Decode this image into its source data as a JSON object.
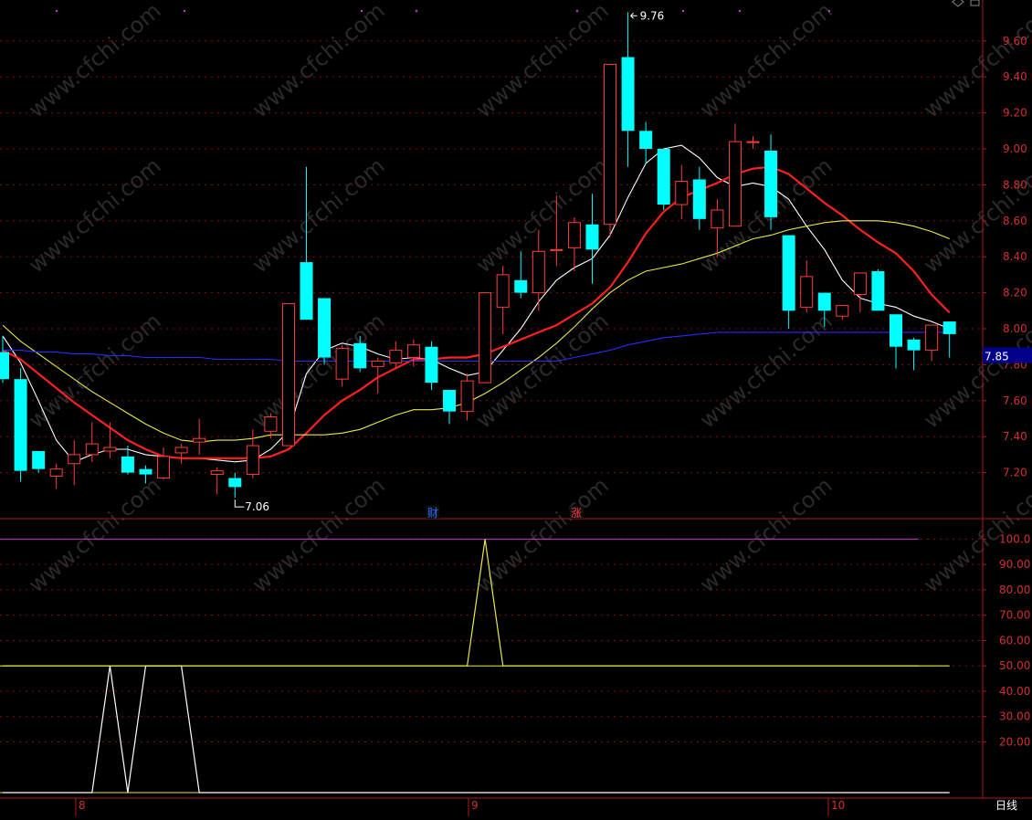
{
  "chart_data": [
    {
      "type": "candlestick",
      "panel": "price",
      "y_ticks": [
        "9.60",
        "9.40",
        "9.20",
        "9.00",
        "8.80",
        "8.60",
        "8.40",
        "8.20",
        "8.00",
        "7.80",
        "7.60",
        "7.40",
        "7.20"
      ],
      "ylim": [
        7.0,
        9.8
      ],
      "current_price_label": "7.85",
      "high_annotation": "9.76",
      "low_annotation": "7.06",
      "event_markers": [
        "财",
        "涨"
      ],
      "x_month_labels": [
        "8",
        "9",
        "10"
      ],
      "period_label": "日线",
      "colors": {
        "up": "#ff3c3c",
        "down": "#00ffff",
        "ma_white": "#ffffff",
        "ma_red": "#ff2020",
        "ma_yellow": "#e8e84a",
        "ma_blue": "#2a2aff"
      },
      "candles": [
        {
          "o": 7.87,
          "h": 7.96,
          "l": 7.7,
          "c": 7.72
        },
        {
          "o": 7.72,
          "h": 7.78,
          "l": 7.15,
          "c": 7.21
        },
        {
          "o": 7.32,
          "h": 7.32,
          "l": 7.2,
          "c": 7.22
        },
        {
          "o": 7.18,
          "h": 7.25,
          "l": 7.11,
          "c": 7.22
        },
        {
          "o": 7.25,
          "h": 7.38,
          "l": 7.13,
          "c": 7.3
        },
        {
          "o": 7.3,
          "h": 7.48,
          "l": 7.26,
          "c": 7.36
        },
        {
          "o": 7.32,
          "h": 7.48,
          "l": 7.28,
          "c": 7.34
        },
        {
          "o": 7.29,
          "h": 7.35,
          "l": 7.19,
          "c": 7.2
        },
        {
          "o": 7.22,
          "h": 7.24,
          "l": 7.14,
          "c": 7.19
        },
        {
          "o": 7.17,
          "h": 7.34,
          "l": 7.16,
          "c": 7.29
        },
        {
          "o": 7.31,
          "h": 7.36,
          "l": 7.25,
          "c": 7.34
        },
        {
          "o": 7.37,
          "h": 7.5,
          "l": 7.3,
          "c": 7.39
        },
        {
          "o": 7.19,
          "h": 7.23,
          "l": 7.08,
          "c": 7.21
        },
        {
          "o": 7.17,
          "h": 7.2,
          "l": 7.06,
          "c": 7.12
        },
        {
          "o": 7.19,
          "h": 7.44,
          "l": 7.17,
          "c": 7.35
        },
        {
          "o": 7.43,
          "h": 7.53,
          "l": 7.39,
          "c": 7.51
        },
        {
          "o": 7.35,
          "h": 8.14,
          "l": 7.35,
          "c": 8.14
        },
        {
          "o": 8.37,
          "h": 8.9,
          "l": 8.05,
          "c": 8.05
        },
        {
          "o": 8.17,
          "h": 8.17,
          "l": 7.8,
          "c": 7.84
        },
        {
          "o": 7.72,
          "h": 7.91,
          "l": 7.68,
          "c": 7.89
        },
        {
          "o": 7.92,
          "h": 7.96,
          "l": 7.76,
          "c": 7.78
        },
        {
          "o": 7.79,
          "h": 7.84,
          "l": 7.64,
          "c": 7.82
        },
        {
          "o": 7.81,
          "h": 7.93,
          "l": 7.78,
          "c": 7.88
        },
        {
          "o": 7.84,
          "h": 7.94,
          "l": 7.79,
          "c": 7.91
        },
        {
          "o": 7.9,
          "h": 7.93,
          "l": 7.66,
          "c": 7.7
        },
        {
          "o": 7.66,
          "h": 7.66,
          "l": 7.47,
          "c": 7.54
        },
        {
          "o": 7.54,
          "h": 7.75,
          "l": 7.49,
          "c": 7.71
        },
        {
          "o": 7.7,
          "h": 8.2,
          "l": 7.7,
          "c": 8.2
        },
        {
          "o": 8.12,
          "h": 8.35,
          "l": 7.97,
          "c": 8.3
        },
        {
          "o": 8.27,
          "h": 8.43,
          "l": 8.17,
          "c": 8.2
        },
        {
          "o": 8.2,
          "h": 8.55,
          "l": 8.1,
          "c": 8.43
        },
        {
          "o": 8.44,
          "h": 8.74,
          "l": 8.35,
          "c": 8.44
        },
        {
          "o": 8.45,
          "h": 8.62,
          "l": 8.32,
          "c": 8.59
        },
        {
          "o": 8.58,
          "h": 8.75,
          "l": 8.25,
          "c": 8.44
        },
        {
          "o": 8.58,
          "h": 9.47,
          "l": 8.51,
          "c": 9.47
        },
        {
          "o": 9.51,
          "h": 9.76,
          "l": 8.9,
          "c": 9.1
        },
        {
          "o": 9.1,
          "h": 9.15,
          "l": 8.92,
          "c": 9.0
        },
        {
          "o": 9.0,
          "h": 9.0,
          "l": 8.66,
          "c": 8.69
        },
        {
          "o": 8.69,
          "h": 8.91,
          "l": 8.61,
          "c": 8.82
        },
        {
          "o": 8.83,
          "h": 8.9,
          "l": 8.55,
          "c": 8.61
        },
        {
          "o": 8.56,
          "h": 8.72,
          "l": 8.4,
          "c": 8.66
        },
        {
          "o": 8.57,
          "h": 9.14,
          "l": 8.57,
          "c": 9.04
        },
        {
          "o": 9.04,
          "h": 9.07,
          "l": 9.0,
          "c": 9.04
        },
        {
          "o": 8.99,
          "h": 9.08,
          "l": 8.55,
          "c": 8.62
        },
        {
          "o": 8.52,
          "h": 8.52,
          "l": 8.0,
          "c": 8.1
        },
        {
          "o": 8.12,
          "h": 8.38,
          "l": 8.09,
          "c": 8.29
        },
        {
          "o": 8.2,
          "h": 8.2,
          "l": 8.01,
          "c": 8.1
        },
        {
          "o": 8.07,
          "h": 8.12,
          "l": 8.05,
          "c": 8.13
        },
        {
          "o": 8.19,
          "h": 8.31,
          "l": 8.09,
          "c": 8.31
        },
        {
          "o": 8.32,
          "h": 8.33,
          "l": 8.1,
          "c": 8.1
        },
        {
          "o": 8.08,
          "h": 8.08,
          "l": 7.78,
          "c": 7.9
        },
        {
          "o": 7.94,
          "h": 7.95,
          "l": 7.77,
          "c": 7.88
        },
        {
          "o": 7.88,
          "h": 8.02,
          "l": 7.82,
          "c": 8.02
        },
        {
          "o": 8.04,
          "h": 8.04,
          "l": 7.84,
          "c": 7.97
        }
      ],
      "ma_lines": [
        {
          "name": "MA5",
          "color": "#ffffff",
          "values": [
            7.96,
            7.81,
            7.6,
            7.38,
            7.26,
            7.3,
            7.33,
            7.33,
            7.3,
            7.29,
            7.28,
            7.28,
            7.27,
            7.26,
            7.27,
            7.33,
            7.43,
            7.75,
            7.88,
            7.92,
            7.9,
            7.86,
            7.83,
            7.84,
            7.83,
            7.78,
            7.74,
            7.76,
            7.88,
            8.0,
            8.15,
            8.27,
            8.34,
            8.39,
            8.52,
            8.73,
            8.92,
            9.0,
            9.02,
            8.95,
            8.84,
            8.79,
            8.81,
            8.79,
            8.72,
            8.57,
            8.44,
            8.27,
            8.17,
            8.14,
            8.12,
            8.07,
            8.04,
            8.0
          ]
        },
        {
          "name": "MA10",
          "color": "#ff2020",
          "values": [
            7.88,
            7.83,
            7.75,
            7.67,
            7.59,
            7.52,
            7.45,
            7.38,
            7.33,
            7.29,
            7.28,
            7.28,
            7.28,
            7.28,
            7.28,
            7.29,
            7.33,
            7.42,
            7.52,
            7.6,
            7.66,
            7.73,
            7.78,
            7.83,
            7.83,
            7.84,
            7.84,
            7.86,
            7.9,
            7.94,
            7.98,
            8.02,
            8.08,
            8.14,
            8.23,
            8.37,
            8.53,
            8.65,
            8.73,
            8.77,
            8.81,
            8.86,
            8.89,
            8.9,
            8.86,
            8.78,
            8.7,
            8.63,
            8.55,
            8.48,
            8.42,
            8.32,
            8.19,
            8.09
          ]
        },
        {
          "name": "MA20",
          "color": "#e8e84a",
          "values": [
            8.02,
            7.93,
            7.86,
            7.79,
            7.72,
            7.65,
            7.59,
            7.53,
            7.47,
            7.42,
            7.38,
            7.37,
            7.38,
            7.38,
            7.39,
            7.41,
            7.41,
            7.41,
            7.41,
            7.42,
            7.44,
            7.48,
            7.52,
            7.55,
            7.55,
            7.56,
            7.59,
            7.64,
            7.7,
            7.77,
            7.84,
            7.92,
            8.01,
            8.11,
            8.2,
            8.27,
            8.32,
            8.34,
            8.36,
            8.39,
            8.42,
            8.46,
            8.5,
            8.52,
            8.55,
            8.57,
            8.59,
            8.6,
            8.6,
            8.6,
            8.59,
            8.57,
            8.54,
            8.5
          ]
        },
        {
          "name": "MA60",
          "color": "#2a2aff",
          "values": [
            7.88,
            7.88,
            7.87,
            7.87,
            7.86,
            7.86,
            7.85,
            7.85,
            7.84,
            7.84,
            7.84,
            7.84,
            7.83,
            7.83,
            7.83,
            7.83,
            7.82,
            7.82,
            7.82,
            7.82,
            7.82,
            7.82,
            7.82,
            7.82,
            7.82,
            7.82,
            7.82,
            7.82,
            7.82,
            7.82,
            7.82,
            7.82,
            7.84,
            7.86,
            7.88,
            7.91,
            7.93,
            7.95,
            7.96,
            7.97,
            7.98,
            7.98,
            7.98,
            7.98,
            7.98,
            7.98,
            7.98,
            7.98,
            7.98,
            7.98,
            7.98,
            7.98,
            7.98,
            7.98
          ]
        }
      ]
    },
    {
      "type": "line",
      "panel": "indicator",
      "y_ticks": [
        "100.0",
        "90.00",
        "80.00",
        "70.00",
        "60.00",
        "50.00",
        "40.00",
        "30.00",
        "20.00"
      ],
      "ylim": [
        0,
        100
      ],
      "reference_lines": [
        {
          "value": 100,
          "color": "#cc33cc"
        },
        {
          "value": 50,
          "color": "#e8e84a"
        },
        {
          "value": 0,
          "color": "#e8e84a"
        }
      ],
      "series": [
        {
          "color": "#ffffff",
          "values": [
            0,
            0,
            0,
            0,
            0,
            0,
            50,
            0,
            50,
            50,
            50,
            0,
            0,
            0,
            0,
            0,
            0,
            0,
            0,
            0,
            0,
            0,
            0,
            0,
            0,
            0,
            0,
            0,
            0,
            0,
            0,
            0,
            0,
            0,
            0,
            0,
            0,
            0,
            0,
            0,
            0,
            0,
            0,
            0,
            0,
            0,
            0,
            0,
            0,
            0,
            0,
            0,
            0,
            0
          ]
        },
        {
          "color": "#e8e84a",
          "values": [
            50,
            50,
            50,
            50,
            50,
            50,
            50,
            50,
            50,
            50,
            50,
            50,
            50,
            50,
            50,
            50,
            50,
            50,
            50,
            50,
            50,
            50,
            50,
            50,
            50,
            50,
            50,
            100,
            50,
            50,
            50,
            50,
            50,
            50,
            50,
            50,
            50,
            50,
            50,
            50,
            50,
            50,
            50,
            50,
            50,
            50,
            50,
            50,
            50,
            50,
            50,
            50,
            50,
            50
          ]
        }
      ]
    }
  ],
  "watermark": "www.cfchi.com"
}
